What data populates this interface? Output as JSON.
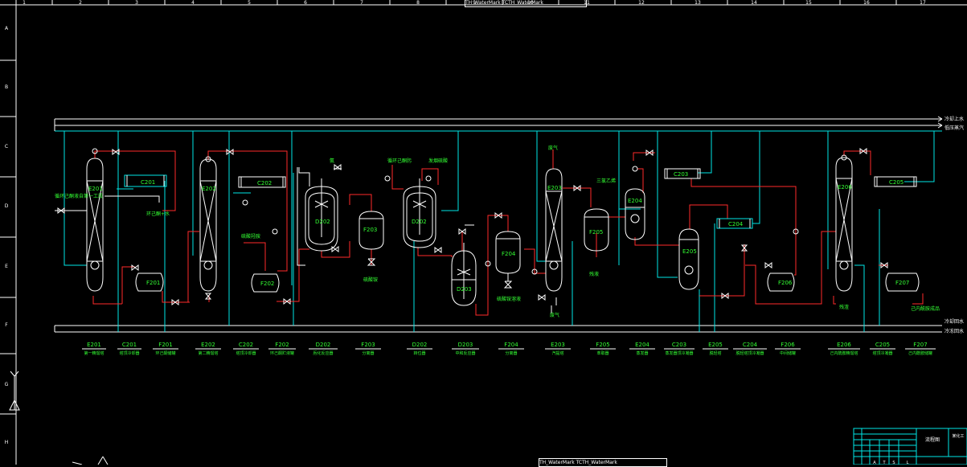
{
  "columns": [
    "1",
    "2",
    "3",
    "4",
    "5",
    "6",
    "7",
    "8",
    "9",
    "10",
    "11",
    "12",
    "13",
    "14",
    "15",
    "16",
    "17"
  ],
  "rows": [
    "A",
    "B",
    "C",
    "D",
    "E",
    "F",
    "G",
    "H"
  ],
  "watermark": "TH_WaterMark  TCTH_WaterMark",
  "utility_lines": {
    "cooling_water_supply": "冷却上水",
    "low_pressure_steam": "低压蒸汽",
    "cooling_water_return": "冷却回水",
    "chilled_water_return": "冷冻回水"
  },
  "equipment": [
    {
      "tag": "E201",
      "name": "第一精馏塔"
    },
    {
      "tag": "C201",
      "name": "塔顶冷却器"
    },
    {
      "tag": "F201",
      "name": "环己酮储罐"
    },
    {
      "tag": "E202",
      "name": "第二精馏塔"
    },
    {
      "tag": "C202",
      "name": "塔顶冷却器"
    },
    {
      "tag": "F202",
      "name": "环己酮贮液罐"
    },
    {
      "tag": "D202",
      "name": "肟化反应器"
    },
    {
      "tag": "F203",
      "name": "分离器"
    },
    {
      "tag": "D202",
      "name": "转位器"
    },
    {
      "tag": "D203",
      "name": "中和反应器"
    },
    {
      "tag": "F204",
      "name": "分离器"
    },
    {
      "tag": "E203",
      "name": "汽提塔"
    },
    {
      "tag": "F205",
      "name": "萃取器"
    },
    {
      "tag": "E204",
      "name": "蒸发器"
    },
    {
      "tag": "C203",
      "name": "蒸发器顶冷凝器"
    },
    {
      "tag": "E205",
      "name": "脱轻塔"
    },
    {
      "tag": "C204",
      "name": "脱轻塔顶冷凝器"
    },
    {
      "tag": "F206",
      "name": "中间储罐"
    },
    {
      "tag": "E206",
      "name": "己内酰胺精馏塔"
    },
    {
      "tag": "C205",
      "name": "塔顶冷凝器"
    },
    {
      "tag": "F207",
      "name": "己内酰胺储罐"
    }
  ],
  "stream_labels": {
    "feed": "循环己酮液自第一工段",
    "cyclohexanone_water": "环己酮+水",
    "ammonia": "氨",
    "hydroxylamine_sulfate": "硫酸羟胺",
    "recycle_cyclohexanone": "循环己酮肟",
    "fuming_sulfuric_acid": "发烟硫酸",
    "ammonium_sulfate_1": "硫酸铵",
    "ammonium_sulfate_2": "硫酸铵溶液",
    "waste_gas_top": "废气",
    "waste_gas_bottom": "废气",
    "trichloroethylene": "三氯乙烯",
    "residue": "残液",
    "bottoms": "残渣",
    "product": "己内酰胺成品"
  },
  "title_block": {
    "drawing_title": "流程图",
    "company": "某化工",
    "revision_marks": [
      "A",
      "T",
      "S",
      "L"
    ]
  }
}
